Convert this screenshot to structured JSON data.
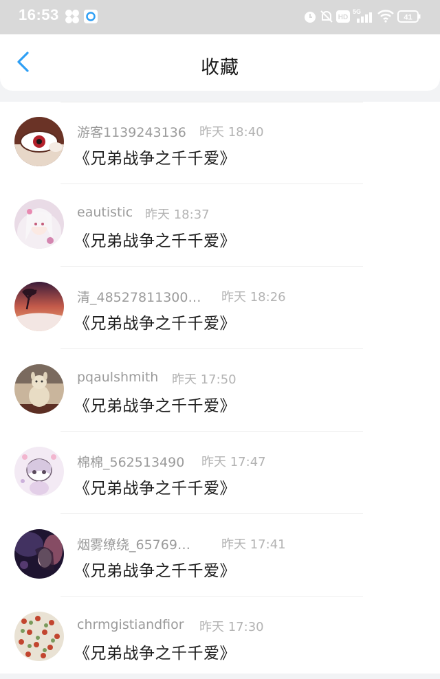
{
  "status_bar": {
    "time": "16:53",
    "battery": "41",
    "network": "5G",
    "hd": "HD",
    "icons": [
      "pinwheel-icon",
      "app-notification-icon",
      "alarm-icon",
      "mute-icon",
      "hd-icon",
      "signal-icon",
      "wifi-icon",
      "battery-icon"
    ]
  },
  "header": {
    "title": "收藏",
    "back_icon": "chevron-left-icon",
    "accent_color": "#2e9ff5"
  },
  "favorites": [
    {
      "user": "游客1139243136",
      "time": "昨天 18:40",
      "title": "《兄弟战争之千千爱》",
      "avatar": "avatar-eye-bowl"
    },
    {
      "user": "eautistic",
      "time": "昨天 18:37",
      "title": "《兄弟战争之千千爱》",
      "avatar": "avatar-anime-girl"
    },
    {
      "user": "清_48527811300…",
      "time": "昨天 18:26",
      "title": "《兄弟战争之千千爱》",
      "avatar": "avatar-sunset-tree"
    },
    {
      "user": "pqaulshmith",
      "time": "昨天 17:50",
      "title": "《兄弟战争之千千爱》",
      "avatar": "avatar-plush-toy"
    },
    {
      "user": "棉棉_562513490",
      "time": "昨天 17:47",
      "title": "《兄弟战争之千千爱》",
      "avatar": "avatar-cute-character"
    },
    {
      "user": "烟雾缭绕_65769…",
      "time": "昨天 17:41",
      "title": "《兄弟战争之千千爱》",
      "avatar": "avatar-dark-portrait"
    },
    {
      "user": "chrmgistiandfior",
      "time": "昨天 17:30",
      "title": "《兄弟战争之千千爱》",
      "avatar": "avatar-flowers"
    }
  ]
}
